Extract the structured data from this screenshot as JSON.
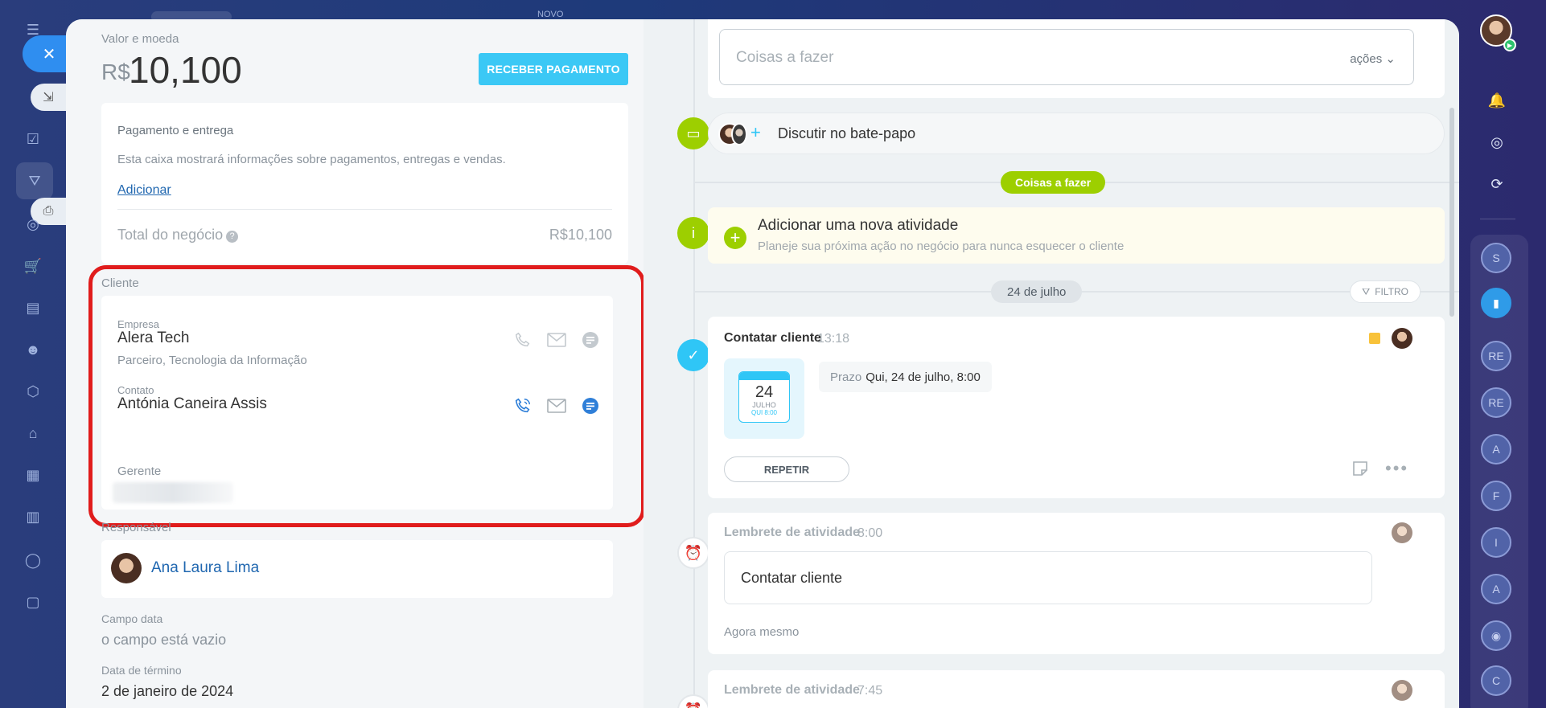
{
  "background": {
    "top_label": "NOVO"
  },
  "left_rail": {
    "icons": [
      "menu-icon",
      "close-icon",
      "collapse-icon",
      "tasks-icon",
      "funnel-icon",
      "print-icon",
      "target-icon",
      "cart-icon",
      "card-icon",
      "robot-icon",
      "box-icon",
      "building-icon",
      "calendar-icon",
      "chart-icon",
      "circle-icon",
      "doc-icon"
    ]
  },
  "deal": {
    "amount_label": "Valor e moeda",
    "currency": "R$",
    "amount": "10,100",
    "pay_button": "RECEBER PAGAMENTO",
    "payment": {
      "title": "Pagamento e entrega",
      "description": "Esta caixa mostrará informações sobre pagamentos, entregas e vendas.",
      "add_link": "Adicionar",
      "total_label": "Total do negócio",
      "total_value": "R$10,100"
    },
    "client": {
      "section_label": "Cliente",
      "company_label": "Empresa",
      "company_name": "Alera Tech",
      "company_desc": "Parceiro, Tecnologia da Informação",
      "contact_label": "Contato",
      "contact_name": "Antónia Caneira Assis",
      "contact_role": "Gerente"
    },
    "responsible": {
      "label": "Responsável",
      "name": "Ana Laura Lima"
    },
    "fields": [
      {
        "label": "Campo data",
        "value": "o campo está vazio"
      },
      {
        "label": "Data de término",
        "value": "2 de janeiro de 2024"
      }
    ]
  },
  "timeline": {
    "todo_placeholder": "Coisas a fazer",
    "todo_actions": "ações",
    "chat_text": "Discutir no bate-papo",
    "todo_badge": "Coisas a fazer",
    "add_activity_title": "Adicionar uma nova atividade",
    "add_activity_sub": "Planeje sua próxima ação no negócio para nunca esquecer o cliente",
    "date_badge": "24 de julho",
    "filter_label": "FILTRO",
    "activity": {
      "title": "Contatar cliente",
      "time": "13:18",
      "cal_day": "24",
      "cal_month": "JULHO",
      "cal_dow": "QUI 8:00",
      "deadline_pre": "Prazo",
      "deadline_value": "Qui, 24 de julho, 8:00",
      "repeat_button": "REPETIR"
    },
    "reminders": [
      {
        "title": "Lembrete de atividade",
        "time": "8:00",
        "text": "Contatar cliente",
        "footer": "Agora mesmo"
      },
      {
        "title": "Lembrete de atividade",
        "time": "7:45"
      }
    ]
  },
  "right_rail": {
    "circles": [
      "S",
      "",
      "RE",
      "RE",
      "A",
      "F",
      "I",
      "A",
      "",
      "C"
    ]
  },
  "colors": {
    "accent_blue": "#3bc8f5",
    "green": "#9dcf00",
    "highlight_red": "#e01c1c",
    "link_blue": "#2067b0"
  }
}
